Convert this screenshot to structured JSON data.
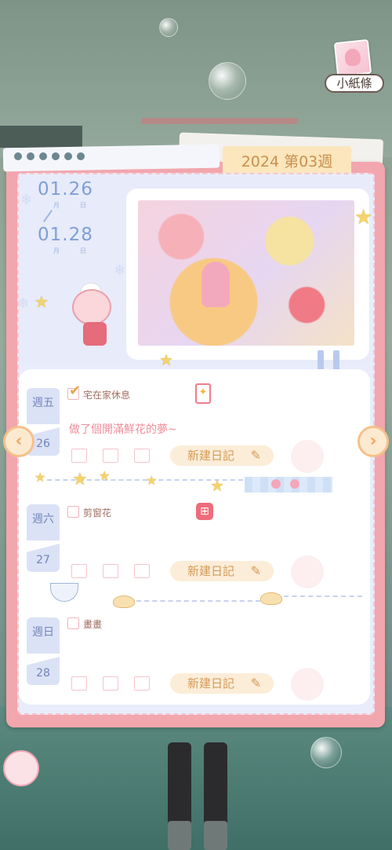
{
  "note_shortcut": {
    "label": "小紙條"
  },
  "week_label": "2024 第03週",
  "date_range": {
    "start": {
      "date": "01.26",
      "month_unit": "月",
      "day_unit": "日"
    },
    "end": {
      "date": "01.28",
      "month_unit": "月",
      "day_unit": "日"
    }
  },
  "days": [
    {
      "weekday": "週五",
      "day": "26",
      "tasks": [
        {
          "text": "宅在家休息",
          "checked": true
        }
      ],
      "diary_text": "做了個開滿鮮花的夢~",
      "new_diary_label": "新建日記"
    },
    {
      "weekday": "週六",
      "day": "27",
      "tasks": [
        {
          "text": "剪窗花",
          "checked": false
        }
      ],
      "diary_text": "",
      "new_diary_label": "新建日記"
    },
    {
      "weekday": "週日",
      "day": "28",
      "tasks": [
        {
          "text": "畫畫",
          "checked": false
        }
      ],
      "diary_text": "",
      "new_diary_label": "新建日記"
    }
  ],
  "nav": {
    "prev_icon": "chevron-left-icon",
    "next_icon": "chevron-right-icon"
  },
  "colors": {
    "book_border": "#f2a6ad",
    "week_tab": "#fbe6bd",
    "date_text": "#7f9fd6",
    "new_button": "#fcedd9",
    "dream_text": "#ef8d9a"
  }
}
